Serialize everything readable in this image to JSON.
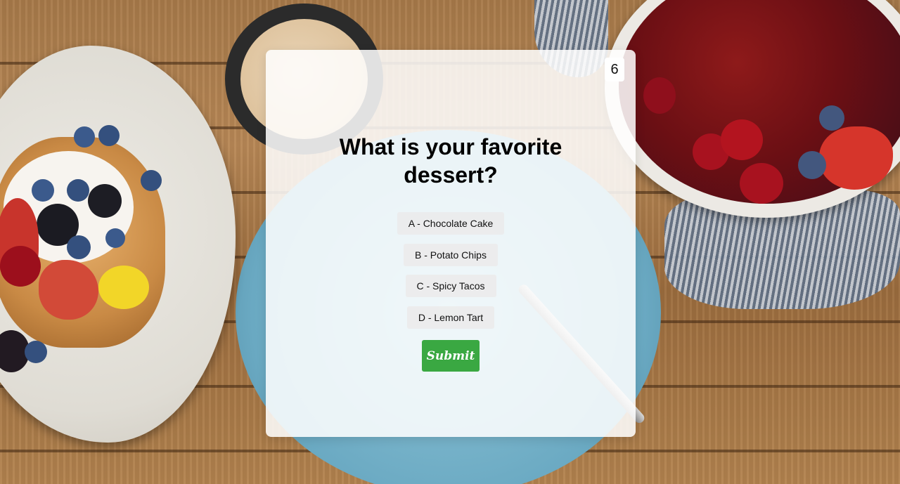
{
  "quiz": {
    "counter": "6",
    "question": "What is your favorite dessert?",
    "options": [
      {
        "label": "A - Chocolate Cake"
      },
      {
        "label": "B - Potato Chips"
      },
      {
        "label": "C - Spicy Tacos"
      },
      {
        "label": "D - Lemon Tart"
      }
    ],
    "submit_label": "Submit"
  },
  "colors": {
    "submit_button": "#3aa842",
    "card_background": "#ffffff",
    "text": "#000000"
  }
}
